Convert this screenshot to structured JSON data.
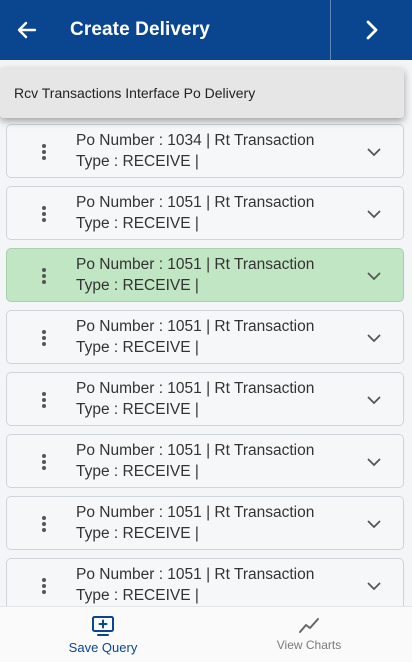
{
  "header": {
    "title": "Create Delivery",
    "back_icon": "arrow-left-icon",
    "next_icon": "chevron-right-icon"
  },
  "dropdown": {
    "value": "Rcv Transactions Interface Po Delivery"
  },
  "transactions": [
    {
      "line1": "Po Number : 1034 | Rt Transaction",
      "line2": "Type : RECEIVE |",
      "selected": false
    },
    {
      "line1": "Po Number : 1051 | Rt Transaction",
      "line2": "Type : RECEIVE |",
      "selected": false
    },
    {
      "line1": "Po Number : 1051 | Rt Transaction",
      "line2": "Type : RECEIVE |",
      "selected": true
    },
    {
      "line1": "Po Number : 1051 | Rt Transaction",
      "line2": "Type : RECEIVE |",
      "selected": false
    },
    {
      "line1": "Po Number : 1051 | Rt Transaction",
      "line2": "Type : RECEIVE |",
      "selected": false
    },
    {
      "line1": "Po Number : 1051 | Rt Transaction",
      "line2": "Type : RECEIVE |",
      "selected": false
    },
    {
      "line1": "Po Number : 1051 | Rt Transaction",
      "line2": "Type : RECEIVE |",
      "selected": false
    },
    {
      "line1": "Po Number : 1051 | Rt Transaction",
      "line2": "Type : RECEIVE |",
      "selected": false
    }
  ],
  "footer": {
    "save_query": "Save Query",
    "view_charts": "View Charts"
  },
  "colors": {
    "header_bg": "#0a4690",
    "selected_row": "#c1e6c3",
    "active_footer": "#0a4690"
  }
}
